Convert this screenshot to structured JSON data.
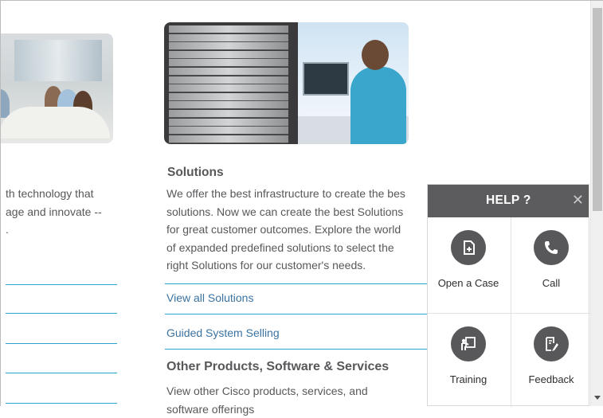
{
  "left_column": {
    "text_lines": [
      "th technology that",
      "age and innovate --",
      "."
    ]
  },
  "solutions": {
    "title": "Solutions",
    "body_lines": [
      "We offer the best infrastructure to create the bes",
      "solutions. Now we can create the best Solutions",
      "for great customer outcomes. Explore the world",
      "of expanded predefined solutions to select the",
      "right Solutions for our customer's needs."
    ],
    "links": [
      "View all Solutions",
      "Guided System Selling"
    ]
  },
  "other_products": {
    "title": "Other Products, Software & Services",
    "body_lines": [
      "View other Cisco products, services, and",
      "software offerings"
    ]
  },
  "help_widget": {
    "title": "HELP ?",
    "close_icon": "close-icon",
    "items": [
      {
        "label": "Open a Case",
        "icon": "case-icon"
      },
      {
        "label": "Call",
        "icon": "phone-icon"
      },
      {
        "label": "Training",
        "icon": "training-icon"
      },
      {
        "label": "Feedback",
        "icon": "feedback-icon"
      }
    ]
  },
  "colors": {
    "link": "#3b73a1",
    "rule": "#2aa5cf",
    "help_header": "#5c5c5f",
    "text": "#58585b"
  }
}
